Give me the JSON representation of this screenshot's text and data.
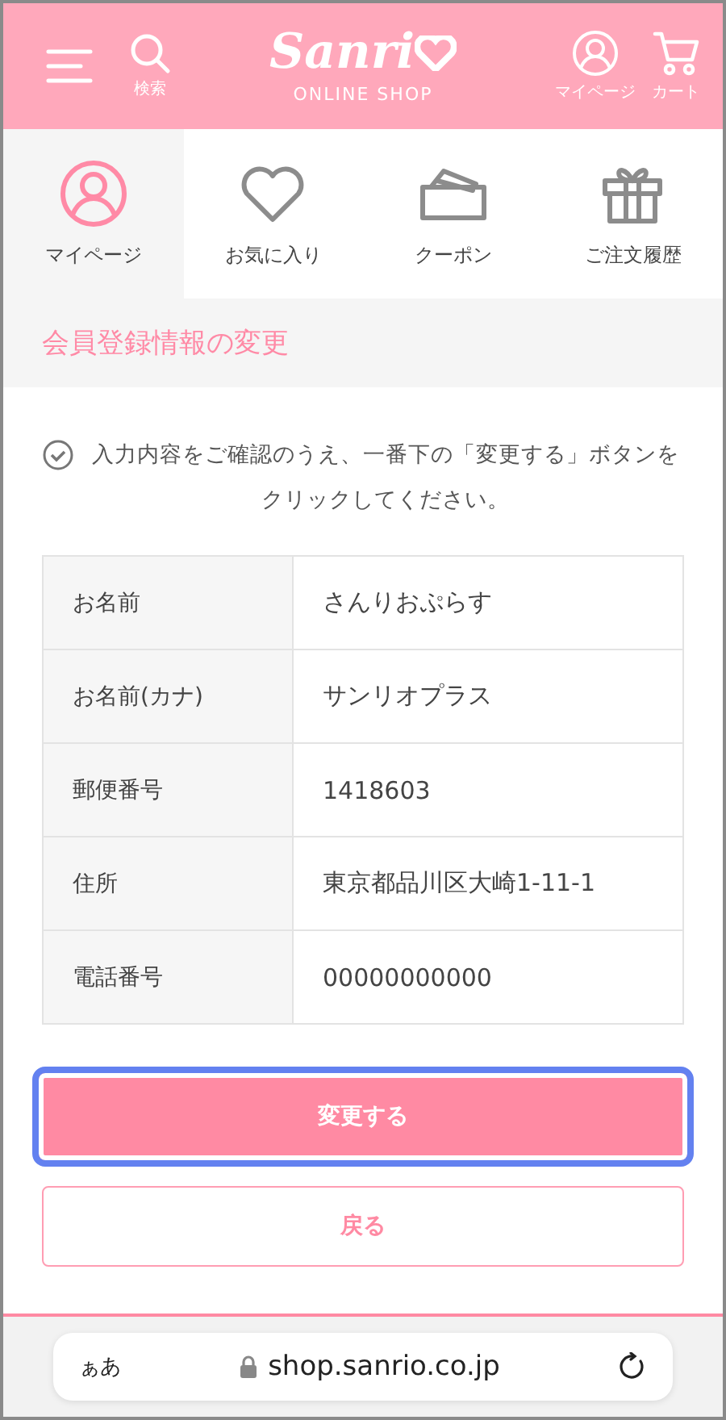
{
  "header": {
    "logo": "Sanri",
    "logo_sub": "ONLINE SHOP",
    "search_label": "検索",
    "mypage_label": "マイページ",
    "cart_label": "カート"
  },
  "tabs": [
    {
      "label": "マイページ",
      "kind": "person",
      "selected": true
    },
    {
      "label": "お気に入り",
      "kind": "heart",
      "selected": false
    },
    {
      "label": "クーポン",
      "kind": "coupon",
      "selected": false
    },
    {
      "label": "ご注文履歴",
      "kind": "gift",
      "selected": false
    }
  ],
  "page_title": "会員登録情報の変更",
  "notice": "入力内容をご確認のうえ、一番下の「変更する」ボタンをクリックしてください。",
  "table": {
    "rows": [
      {
        "label": "お名前",
        "value": "さんりおぷらす"
      },
      {
        "label": "お名前(カナ)",
        "value": "サンリオプラス"
      },
      {
        "label": "郵便番号",
        "value": "1418603"
      },
      {
        "label": "住所",
        "value": "東京都品川区大崎1-11-1"
      },
      {
        "label": "電話番号",
        "value": "00000000000"
      }
    ]
  },
  "buttons": [
    {
      "kind": "primary",
      "label": "変更する",
      "focused": true
    },
    {
      "kind": "secondary",
      "label": "戻る",
      "focused": false
    }
  ],
  "browser_bar": {
    "text_size": "ぁあ",
    "url": "shop.sanrio.co.jp"
  }
}
